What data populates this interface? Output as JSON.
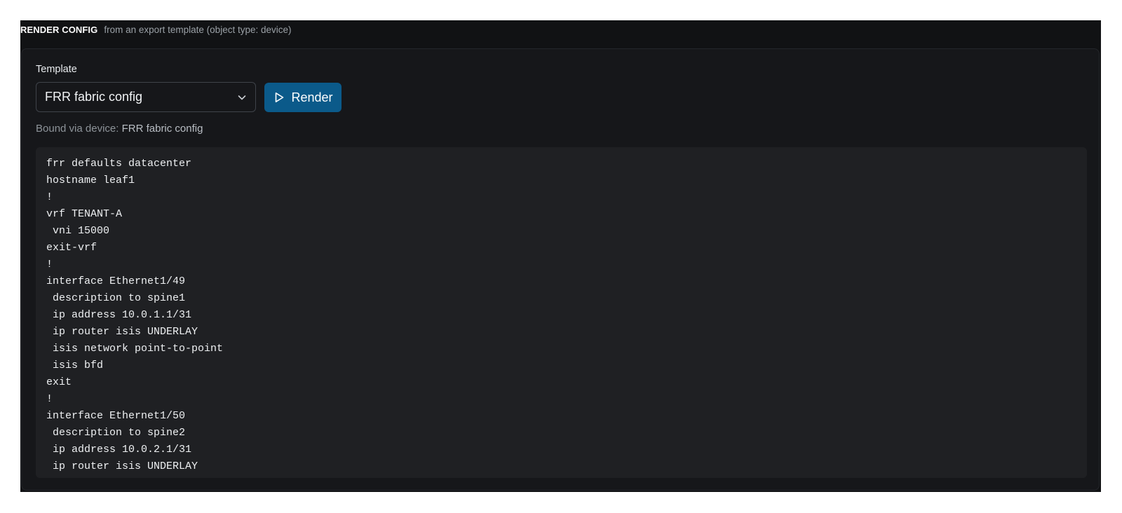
{
  "header": {
    "title": "RENDER CONFIG",
    "subtitle": "from an export template (object type: device)"
  },
  "form": {
    "template_label": "Template",
    "template_selected": "FRR fabric config",
    "render_label": "Render",
    "bound_prefix": "Bound via device:",
    "bound_name": "FRR fabric config"
  },
  "icons": {
    "select_chevron": "chevron-down-icon",
    "render": "play-icon"
  },
  "colors": {
    "accent": "#0b5a8a",
    "panel_bg": "#111214",
    "code_bg": "#1f2023"
  },
  "output": {
    "lines": [
      "frr defaults datacenter",
      "hostname leaf1",
      "!",
      "vrf TENANT-A",
      " vni 15000",
      "exit-vrf",
      "!",
      "interface Ethernet1/49",
      " description to spine1",
      " ip address 10.0.1.1/31",
      " ip router isis UNDERLAY",
      " isis network point-to-point",
      " isis bfd",
      "exit",
      "!",
      "interface Ethernet1/50",
      " description to spine2",
      " ip address 10.0.2.1/31",
      " ip router isis UNDERLAY"
    ]
  }
}
